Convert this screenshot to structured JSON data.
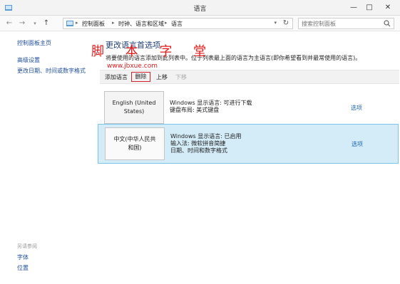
{
  "window": {
    "title": "语言"
  },
  "address": {
    "breadcrumbs": [
      "控制面板",
      "时钟、语言和区域",
      "语言"
    ],
    "search_placeholder": "搜索控制面板"
  },
  "sidebar": {
    "home_link": "控制面板主页",
    "links": [
      "高级设置",
      "更改日期、时间或数字格式"
    ],
    "see_also_heading": "另请参阅",
    "see_also_links": [
      "字体",
      "位置"
    ]
  },
  "main": {
    "title": "更改语言首选项",
    "description": "将要使用的语言添加到此列表中。位于列表最上面的语言为主语言(即你希望看到并最常使用的语言)。"
  },
  "watermark": {
    "text": "脚 本 字 堂",
    "url": "www.jbxue.com"
  },
  "toolbar": {
    "add": "添加语言",
    "delete": "删除",
    "up": "上移",
    "down": "下移"
  },
  "languages": [
    {
      "tile_line1": "English (United",
      "tile_line2": "States)",
      "info_line1": "Windows 显示语言: 可进行下载",
      "info_line2": "键盘布局: 美式键盘",
      "info_line3": "",
      "options": "选项"
    },
    {
      "tile_line1": "中文(中华人民共",
      "tile_line2": "和国)",
      "info_line1": "Windows 显示语言: 已启用",
      "info_line2": "输入法: 微软拼音简捷",
      "info_line3": "日期、时间和数字格式",
      "options": "选项"
    }
  ],
  "colors": {
    "accent": "#1e64b4",
    "selected_row": "#d4ecf8",
    "highlight_box": "#d2232a",
    "watermark": "#e01b1b"
  }
}
